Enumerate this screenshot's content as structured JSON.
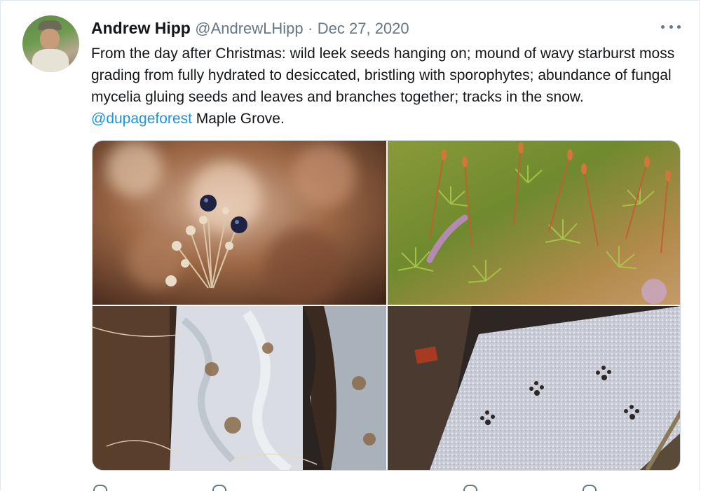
{
  "tweet": {
    "author_name": "Andrew Hipp",
    "author_handle": "@AndrewLHipp",
    "separator": "·",
    "date": "Dec 27, 2020",
    "more_icon": "more-horizontal-icon",
    "text_before_mention": "From the day after Christmas: wild leek seeds hanging on; mound of wavy starburst moss grading from fully hydrated to desiccated, bristling with sporophytes; abundance of fungal mycelia gluing seeds and leaves and branches together; tracks in the snow. ",
    "mention": "@dupageforest",
    "text_after_mention": " Maple Grove.",
    "colors": {
      "link": "#1b95e0",
      "text": "#14171a",
      "secondary": "#657786"
    }
  }
}
